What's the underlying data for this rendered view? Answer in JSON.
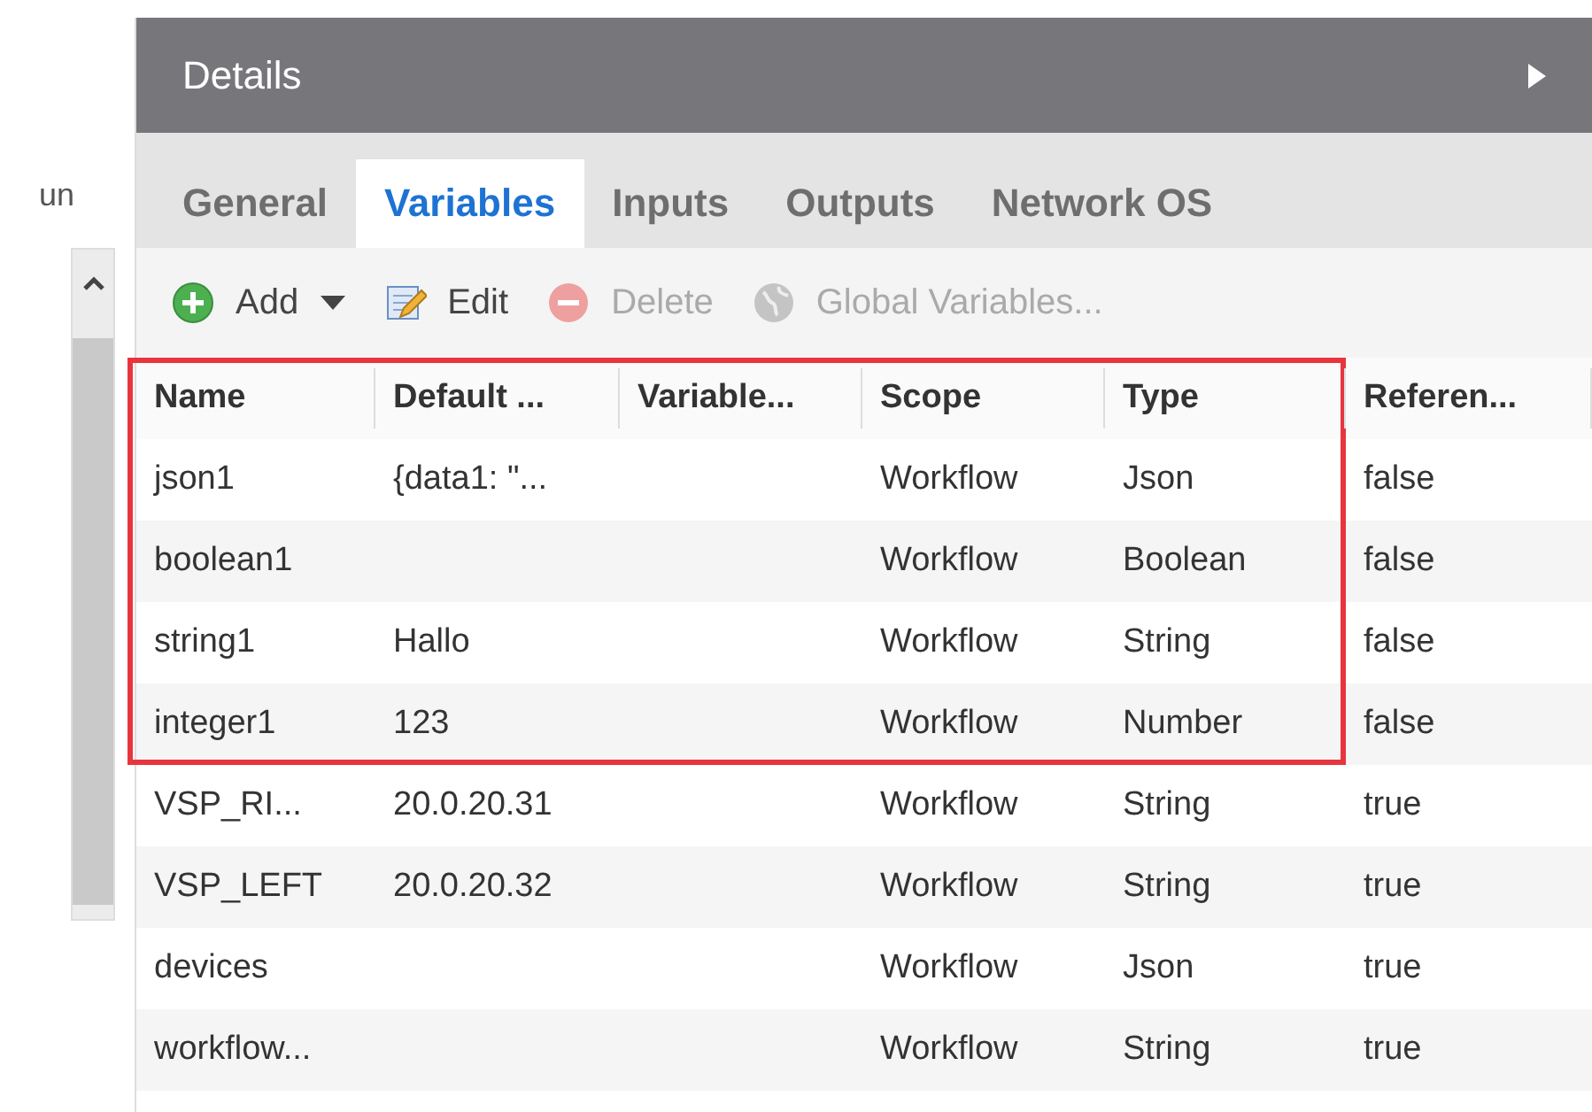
{
  "left_panel": {
    "label": "un"
  },
  "panel": {
    "title": "Details"
  },
  "tabs": [
    {
      "label": "General",
      "selected": false
    },
    {
      "label": "Variables",
      "selected": true
    },
    {
      "label": "Inputs",
      "selected": false
    },
    {
      "label": "Outputs",
      "selected": false
    },
    {
      "label": "Network OS",
      "selected": false
    }
  ],
  "toolbar": [
    {
      "kind": "add",
      "label": "Add",
      "disabled": false,
      "dropdown": true
    },
    {
      "kind": "edit",
      "label": "Edit",
      "disabled": false,
      "dropdown": false
    },
    {
      "kind": "delete",
      "label": "Delete",
      "disabled": true,
      "dropdown": false
    },
    {
      "kind": "global",
      "label": "Global Variables...",
      "disabled": true,
      "dropdown": false
    }
  ],
  "table": {
    "columns": [
      {
        "label": "Name"
      },
      {
        "label": "Default ..."
      },
      {
        "label": "Variable..."
      },
      {
        "label": "Scope"
      },
      {
        "label": "Type"
      },
      {
        "label": "Referen..."
      }
    ],
    "rows": [
      {
        "cells": [
          "json1",
          "{data1: \"...",
          "",
          "Workflow",
          "Json",
          "false"
        ],
        "highlighted": true
      },
      {
        "cells": [
          "boolean1",
          "",
          "",
          "Workflow",
          "Boolean",
          "false"
        ],
        "highlighted": true
      },
      {
        "cells": [
          "string1",
          "Hallo",
          "",
          "Workflow",
          "String",
          "false"
        ],
        "highlighted": true
      },
      {
        "cells": [
          "integer1",
          "123",
          "",
          "Workflow",
          "Number",
          "false"
        ],
        "highlighted": true
      },
      {
        "cells": [
          "VSP_RI...",
          "20.0.20.31",
          "",
          "Workflow",
          "String",
          "true"
        ],
        "highlighted": false
      },
      {
        "cells": [
          "VSP_LEFT",
          "20.0.20.32",
          "",
          "Workflow",
          "String",
          "true"
        ],
        "highlighted": false
      },
      {
        "cells": [
          "devices",
          "",
          "",
          "Workflow",
          "Json",
          "true"
        ],
        "highlighted": false
      },
      {
        "cells": [
          "workflow...",
          "",
          "",
          "Workflow",
          "String",
          "true"
        ],
        "highlighted": false
      }
    ]
  }
}
